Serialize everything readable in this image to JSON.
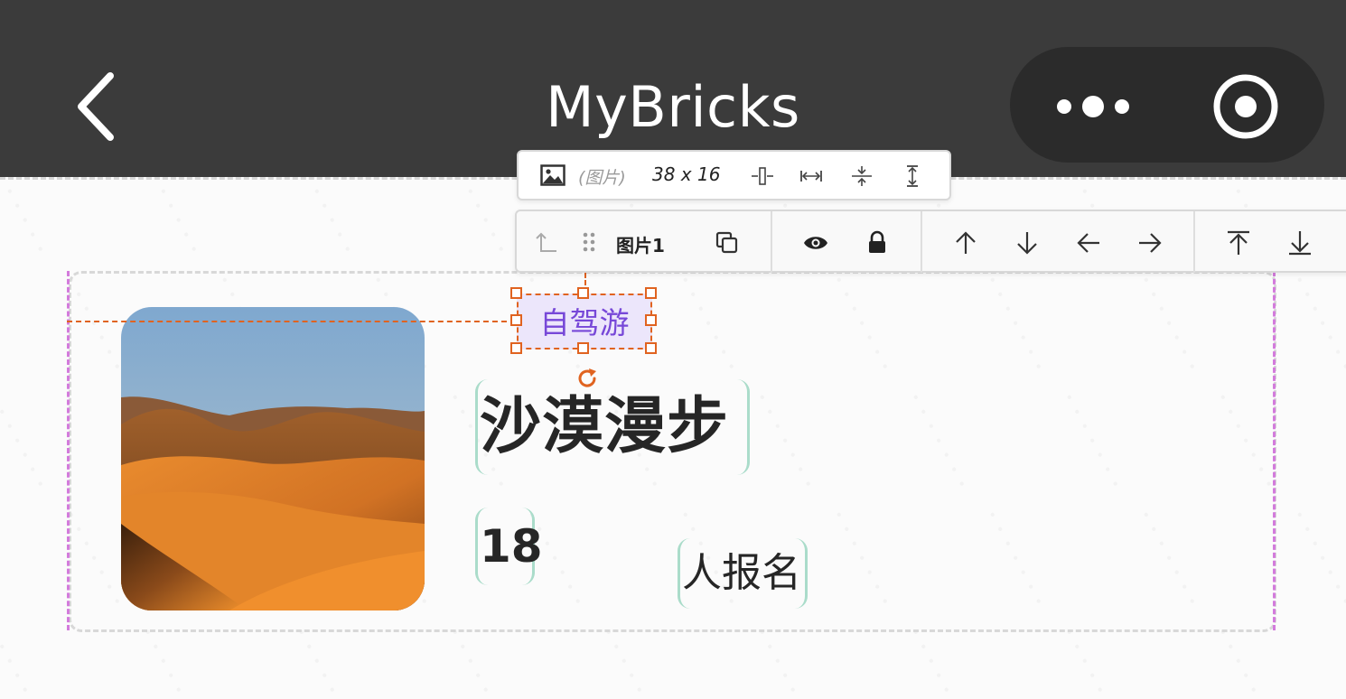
{
  "header": {
    "title": "MyBricks"
  },
  "info_toolbar": {
    "type_label": "(图片)",
    "size_label": "38 x 16"
  },
  "action_toolbar": {
    "layer_name": "图片1"
  },
  "card": {
    "tag": "自驾游",
    "title": "沙漠漫步",
    "count": "18",
    "signup_label": "人报名"
  },
  "colors": {
    "header_bg": "#3b3b3b",
    "selection": "#e06320",
    "tag_bg": "#ece6fb",
    "tag_text": "#7748d8",
    "text_box_border": "#aadcca",
    "card_edge": "#d37bdc"
  }
}
